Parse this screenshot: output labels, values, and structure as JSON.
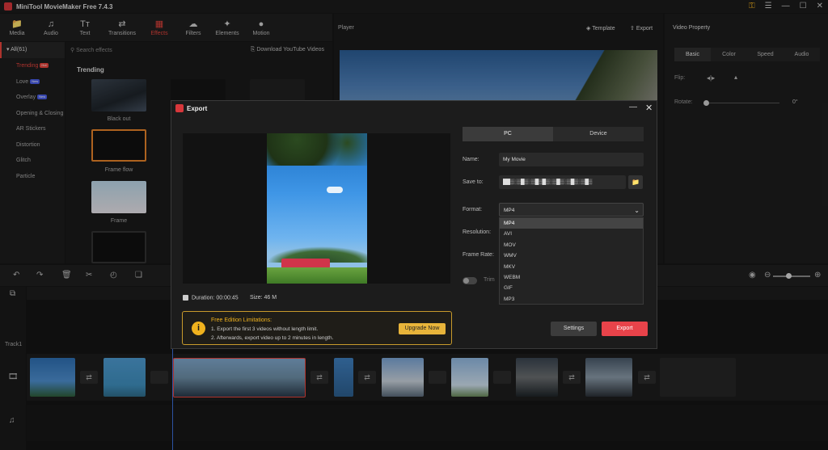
{
  "app": {
    "title": "MiniTool MovieMaker Free 7.4.3"
  },
  "toolbar": {
    "items": [
      {
        "label": "Media",
        "icon": "folder-icon"
      },
      {
        "label": "Audio",
        "icon": "music-note-icon"
      },
      {
        "label": "Text",
        "icon": "text-icon"
      },
      {
        "label": "Transitions",
        "icon": "transitions-icon"
      },
      {
        "label": "Effects",
        "icon": "effects-icon"
      },
      {
        "label": "Filters",
        "icon": "filters-icon"
      },
      {
        "label": "Elements",
        "icon": "elements-icon"
      },
      {
        "label": "Motion",
        "icon": "motion-icon"
      }
    ],
    "active": "Effects"
  },
  "categories": {
    "all_label": "All(61)",
    "items": [
      {
        "label": "Trending",
        "badge": "Hot"
      },
      {
        "label": "Love",
        "badge": "New"
      },
      {
        "label": "Overlay",
        "badge": "New"
      },
      {
        "label": "Opening & Closing",
        "badge": ""
      },
      {
        "label": "AR Stickers",
        "badge": ""
      },
      {
        "label": "Distortion",
        "badge": ""
      },
      {
        "label": "Glitch",
        "badge": ""
      },
      {
        "label": "Particle",
        "badge": ""
      }
    ]
  },
  "effects": {
    "search_placeholder": "Search effects",
    "download_label": "Download YouTube Videos",
    "section_title": "Trending",
    "thumbs": [
      "Black out",
      "Frame flow",
      "Frame"
    ]
  },
  "player": {
    "title": "Player",
    "template_label": "Template",
    "export_label": "Export"
  },
  "video_property": {
    "title": "Video Property",
    "tabs": [
      "Basic",
      "Color",
      "Speed",
      "Audio"
    ],
    "active_tab": "Basic",
    "flip_label": "Flip:",
    "rotate_label": "Rotate:",
    "rotate_value": "0°"
  },
  "timeline": {
    "track_label": "Track1"
  },
  "export_dialog": {
    "title": "Export",
    "tabs": [
      "PC",
      "Device"
    ],
    "active_tab": "PC",
    "name_label": "Name:",
    "name_value": "My Movie",
    "save_label": "Save to:",
    "save_value": "██▒░▒█▒░▒█▒█▒░▒█▒░▒█▒░▒█▒",
    "format_label": "Format:",
    "format_value": "MP4",
    "resolution_label": "Resolution:",
    "frame_rate_label": "Frame Rate:",
    "format_options": [
      "MP4",
      "AVI",
      "MOV",
      "WMV",
      "MKV",
      "WEBM",
      "GIF",
      "MP3"
    ],
    "trim_label": "Trim",
    "duration_label": "Duration:  00:00:45",
    "size_label": "Size:  46 M",
    "limits": {
      "title": "Free Edition Limitations:",
      "line1": "1. Export the first 3 videos without length limit.",
      "line2": "2. Afterwards, export video up to 2 minutes in length.",
      "upgrade_label": "Upgrade Now"
    },
    "settings_label": "Settings",
    "export_label": "Export"
  },
  "colors": {
    "accent": "#e9443c",
    "export_button": "#e8434a",
    "upgrade_button": "#e8b43a",
    "playhead": "#3c6fd8"
  }
}
